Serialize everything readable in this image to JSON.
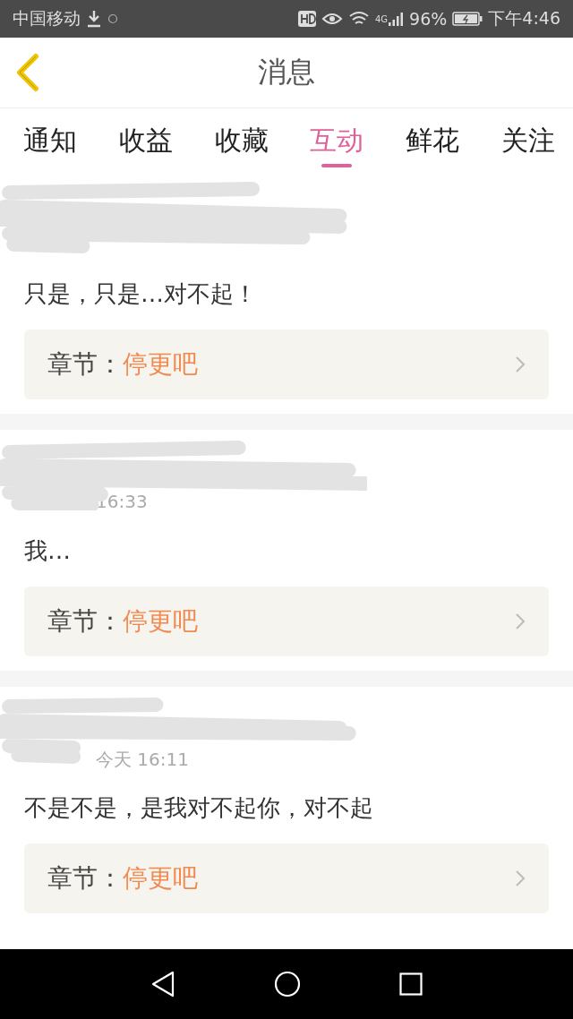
{
  "status_bar": {
    "carrier": "中国移动",
    "battery": "96%",
    "network": "4G",
    "time": "下午4:46"
  },
  "header": {
    "title": "消息"
  },
  "tabs": [
    {
      "label": "通知",
      "selected": false
    },
    {
      "label": "收益",
      "selected": false
    },
    {
      "label": "收藏",
      "selected": false
    },
    {
      "label": "互动",
      "selected": true
    },
    {
      "label": "鲜花",
      "selected": false
    },
    {
      "label": "关注",
      "selected": false
    }
  ],
  "messages": [
    {
      "comment": "只是，只是…对不起！",
      "chapter_label": "章节：",
      "chapter": "停更吧"
    },
    {
      "time": "16:33",
      "comment": "我…",
      "chapter_label": "章节：",
      "chapter": "停更吧"
    },
    {
      "time": "今天 16:11",
      "comment": "不是不是，是我对不起你，对不起",
      "chapter_label": "章节：",
      "chapter": "停更吧"
    }
  ]
}
